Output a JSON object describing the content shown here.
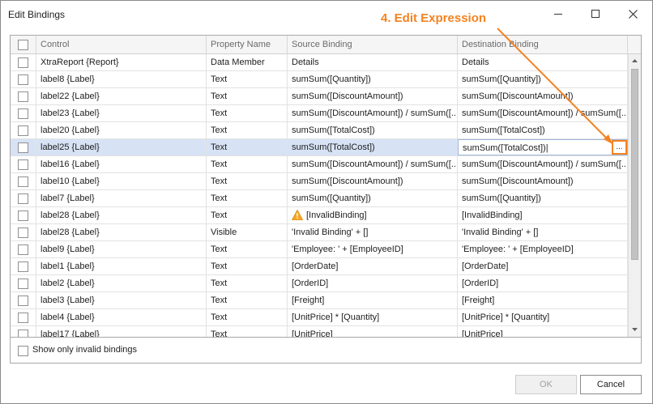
{
  "window": {
    "title": "Edit Bindings",
    "minimize_icon": "minimize-icon",
    "maximize_icon": "maximize-icon",
    "close_icon": "close-icon"
  },
  "annotation": {
    "text": "4. Edit Expression",
    "color": "#f58220"
  },
  "grid": {
    "columns": [
      "Control",
      "Property Name",
      "Source Binding",
      "Destination Binding"
    ],
    "rows": [
      {
        "control": "XtraReport {Report}",
        "property": "Data Member",
        "source": "Details",
        "destination": "Details"
      },
      {
        "control": "label8 {Label}",
        "property": "Text",
        "source": "sumSum([Quantity])",
        "destination": "sumSum([Quantity])"
      },
      {
        "control": "label22 {Label}",
        "property": "Text",
        "source": "sumSum([DiscountAmount])",
        "destination": "sumSum([DiscountAmount])"
      },
      {
        "control": "label23 {Label}",
        "property": "Text",
        "source": "sumSum([DiscountAmount]) / sumSum([...",
        "destination": "sumSum([DiscountAmount]) / sumSum([..."
      },
      {
        "control": "label20 {Label}",
        "property": "Text",
        "source": "sumSum([TotalCost])",
        "destination": "sumSum([TotalCost])"
      },
      {
        "control": "label25 {Label}",
        "property": "Text",
        "source": "sumSum([TotalCost])",
        "destination": "sumSum([TotalCost])|"
      },
      {
        "control": "label16 {Label}",
        "property": "Text",
        "source": "sumSum([DiscountAmount]) / sumSum([...",
        "destination": "sumSum([DiscountAmount]) / sumSum([..."
      },
      {
        "control": "label10 {Label}",
        "property": "Text",
        "source": "sumSum([DiscountAmount])",
        "destination": "sumSum([DiscountAmount])"
      },
      {
        "control": "label7 {Label}",
        "property": "Text",
        "source": "sumSum([Quantity])",
        "destination": "sumSum([Quantity])"
      },
      {
        "control": "label28 {Label}",
        "property": "Text",
        "source": "[InvalidBinding]",
        "destination": "[InvalidBinding]"
      },
      {
        "control": "label28 {Label}",
        "property": "Visible",
        "source": "'Invalid Binding' + []",
        "destination": "'Invalid Binding' + []"
      },
      {
        "control": "label9 {Label}",
        "property": "Text",
        "source": "'Employee: ' + [EmployeeID]",
        "destination": "'Employee: ' + [EmployeeID]"
      },
      {
        "control": "label1 {Label}",
        "property": "Text",
        "source": "[OrderDate]",
        "destination": "[OrderDate]"
      },
      {
        "control": "label2 {Label}",
        "property": "Text",
        "source": "[OrderID]",
        "destination": "[OrderID]"
      },
      {
        "control": "label3 {Label}",
        "property": "Text",
        "source": "[Freight]",
        "destination": "[Freight]"
      },
      {
        "control": "label4 {Label}",
        "property": "Text",
        "source": "[UnitPrice] * [Quantity]",
        "destination": "[UnitPrice] * [Quantity]"
      },
      {
        "control": "label17 {Label}",
        "property": "Text",
        "source": "[UnitPrice]",
        "destination": "[UnitPrice]"
      }
    ],
    "selected_row": 5,
    "warning_row": 9,
    "ellipsis_label": "...",
    "warning_icon": "warning-icon"
  },
  "filter": {
    "label": "Show only invalid bindings"
  },
  "buttons": {
    "ok": "OK",
    "cancel": "Cancel"
  }
}
